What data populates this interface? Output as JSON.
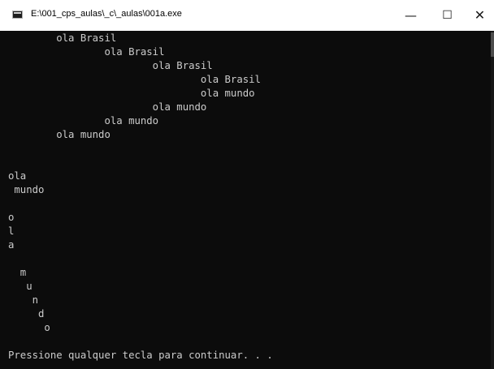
{
  "window": {
    "title": "E:\\001_cps_aulas\\_c\\_aulas\\001a.exe",
    "controls": {
      "minimize": "—",
      "maximize": "☐",
      "close": "✕"
    }
  },
  "console": {
    "lines": [
      "        ola Brasil",
      "                ola Brasil",
      "                        ola Brasil",
      "                                ola Brasil",
      "                                ola mundo",
      "                        ola mundo",
      "                ola mundo",
      "        ola mundo",
      "",
      "",
      "ola",
      " mundo",
      "",
      "o",
      "l",
      "a",
      "",
      "",
      "  m",
      "   u",
      "    n",
      "     d",
      "      o",
      "",
      "Pressione qualquer tecla para continuar. . ."
    ]
  }
}
